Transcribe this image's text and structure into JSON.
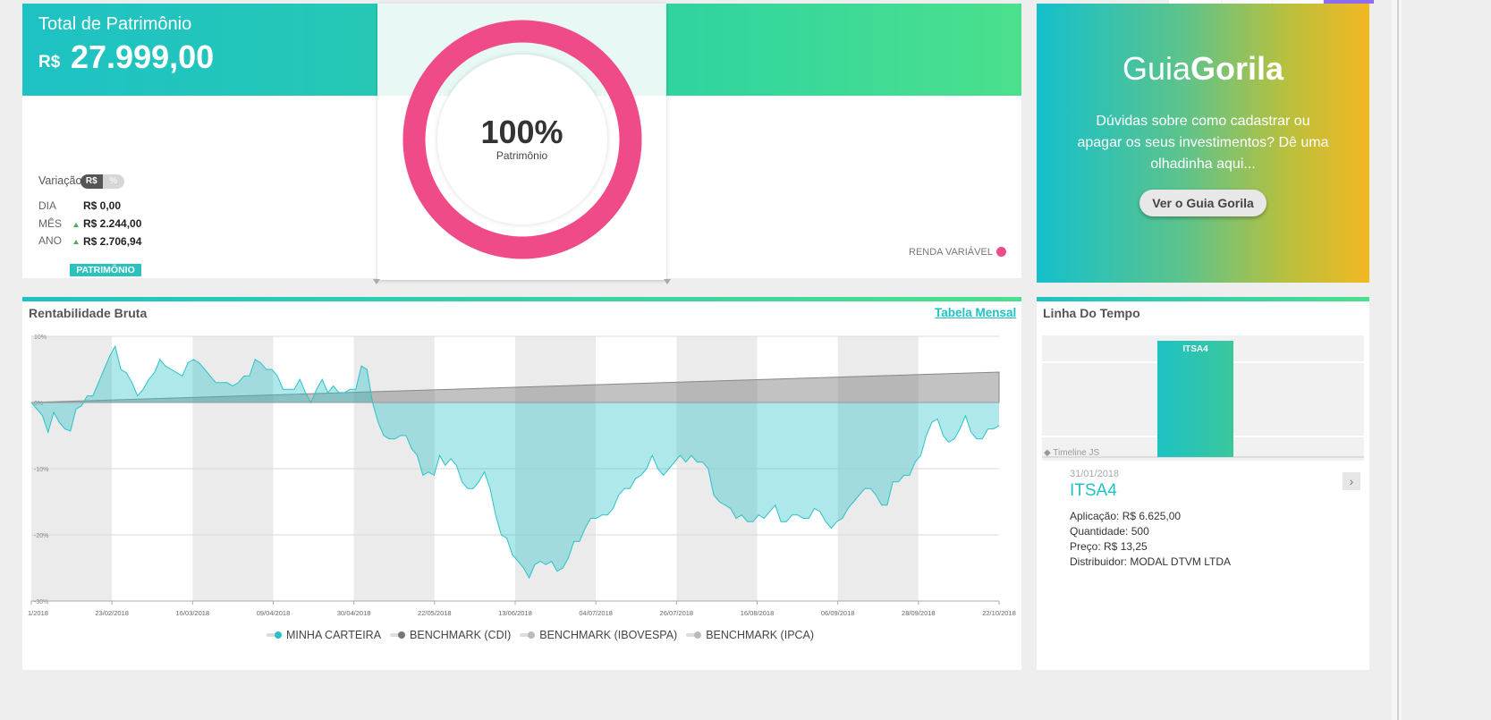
{
  "patrimonio": {
    "title": "Total de Patrimônio",
    "currency": "R$",
    "value": "27.999,00",
    "variacao_label": "Variação",
    "toggle_rs": "R$",
    "toggle_pct": "%",
    "rows": [
      {
        "label": "DIA",
        "value": "R$ 0,00",
        "trend": "none"
      },
      {
        "label": "MÊS",
        "value": "R$ 2.244,00",
        "trend": "up"
      },
      {
        "label": "ANO",
        "value": "R$ 2.706,94",
        "trend": "up"
      }
    ],
    "badge": "PATRIMÔNIO",
    "donut_pct": "100%",
    "donut_sub": "Patrimônio",
    "donut_fraction": 1.0,
    "donut_color": "#ee4b88",
    "legend_label": "RENDA VARIÁVEL"
  },
  "guia": {
    "logo_light": "Guia",
    "logo_bold": "Gorila",
    "text": "Dúvidas sobre como cadastrar ou apagar os seus investimentos? Dê uma olhadinha aqui...",
    "button": "Ver o Guia Gorila"
  },
  "rentabilidade": {
    "title": "Rentabilidade Bruta",
    "link": "Tabela Mensal"
  },
  "chart_data": {
    "type": "area",
    "ylim": [
      -30,
      10
    ],
    "yticks": [
      "10%",
      "0%",
      "-10%",
      "-20%",
      "-30%"
    ],
    "ytick_values": [
      10,
      0,
      -10,
      -20,
      -30
    ],
    "xtick_labels": [
      "1/2018",
      "23/02/2018",
      "16/03/2018",
      "09/04/2018",
      "30/04/2018",
      "22/05/2018",
      "13/06/2018",
      "04/07/2018",
      "26/07/2018",
      "16/08/2018",
      "06/09/2018",
      "28/09/2018",
      "22/10/2018"
    ],
    "series": [
      {
        "name": "MINHA CARTEIRA",
        "color": "#2ac2c9",
        "values": [
          0,
          -1,
          -2,
          -4.5,
          -1.5,
          -3,
          -4,
          -4.3,
          -1,
          -0.5,
          1,
          1,
          3,
          5,
          7,
          8.5,
          5,
          4.5,
          3,
          1,
          2,
          3.5,
          4.5,
          6.5,
          5.5,
          5,
          4.5,
          4,
          6,
          6.5,
          6,
          5,
          4,
          3,
          3,
          3,
          2.5,
          3,
          4,
          4,
          6.5,
          6,
          5,
          5,
          4,
          2,
          2,
          2,
          3.5,
          1.5,
          0,
          2,
          3.5,
          1.5,
          2.5,
          1.5,
          1.5,
          2,
          2,
          5.5,
          5,
          0,
          -3,
          -5,
          -5.5,
          -5.5,
          -5,
          -5,
          -7,
          -8,
          -11,
          -10.5,
          -11,
          -8,
          -9.5,
          -8.5,
          -9.5,
          -12,
          -13,
          -13,
          -12,
          -10.5,
          -13,
          -17,
          -20,
          -20.5,
          -23,
          -24,
          -25,
          -26.5,
          -24.5,
          -24,
          -24.5,
          -24,
          -25.5,
          -25,
          -23.5,
          -21,
          -21,
          -19,
          -17.5,
          -17.5,
          -17,
          -17,
          -16,
          -14,
          -13,
          -13,
          -11.5,
          -11,
          -10,
          -8,
          -10,
          -11,
          -10,
          -9,
          -8,
          -9,
          -8,
          -9,
          -9,
          -10,
          -14,
          -15,
          -15.5,
          -16,
          -17.5,
          -17,
          -18,
          -18,
          -17,
          -17.5,
          -16.5,
          -15.5,
          -18,
          -18,
          -17,
          -17,
          -17.5,
          -17.5,
          -16,
          -16.5,
          -18,
          -19,
          -18,
          -17.5,
          -16,
          -15,
          -14,
          -13,
          -13,
          -14,
          -15.5,
          -15.5,
          -12,
          -12,
          -11,
          -11,
          -9,
          -8,
          -5,
          -3,
          -2.5,
          -5,
          -6,
          -5.5,
          -4,
          -2,
          -4.5,
          -5.5,
          -5.5,
          -4,
          -4,
          -3.5
        ]
      },
      {
        "name": "BENCHMARK (CDI)",
        "color": "#777777",
        "values": [
          0,
          4.6
        ]
      },
      {
        "name": "BENCHMARK (IBOVESPA)",
        "color": "#bbbbbb",
        "values": []
      },
      {
        "name": "BENCHMARK (IPCA)",
        "color": "#bbbbbb",
        "values": []
      }
    ],
    "legend_placement": "bottom",
    "grid": true
  },
  "linha": {
    "title": "Linha Do Tempo",
    "bar_label": "ITSA4",
    "timeline_js": "◆ Timeline JS",
    "date": "31/01/2018",
    "ticker": "ITSA4",
    "details": [
      "Aplicação: R$ 6.625,00",
      "Quantidade: 500",
      "Preço: R$ 13,25",
      "Distribuidor: MODAL DTVM LTDA"
    ],
    "next_icon": "›"
  }
}
